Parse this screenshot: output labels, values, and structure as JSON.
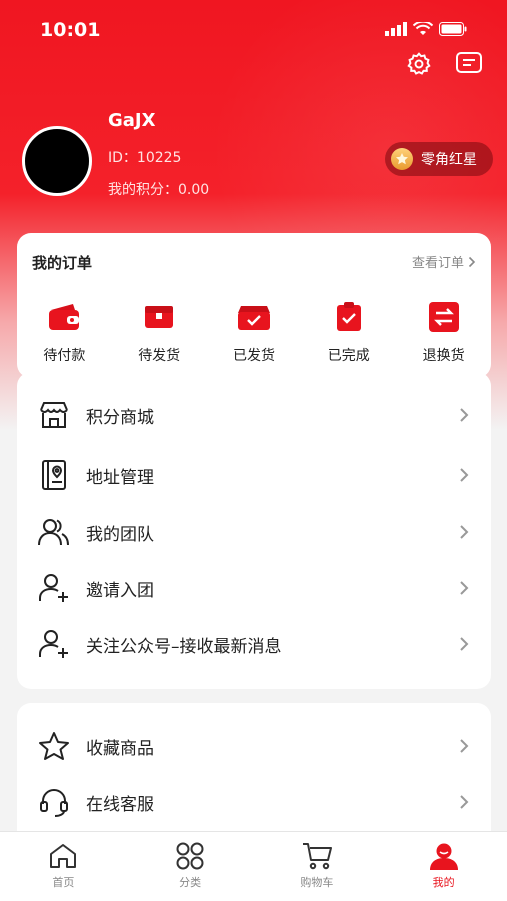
{
  "status_bar": {
    "time": "10:01"
  },
  "profile": {
    "username": "GaJX",
    "id_text": "ID：10225",
    "points_text": "我的积分：0.00",
    "level_badge": "零角红星"
  },
  "orders": {
    "title": "我的订单",
    "view_all": "查看订单",
    "items": [
      {
        "label": "待付款",
        "icon": "wallet-icon"
      },
      {
        "label": "待发货",
        "icon": "package-icon"
      },
      {
        "label": "已发货",
        "icon": "shipped-box-icon"
      },
      {
        "label": "已完成",
        "icon": "clipboard-check-icon"
      },
      {
        "label": "退换货",
        "icon": "exchange-icon"
      }
    ]
  },
  "menu_primary": [
    {
      "label": "积分商城",
      "icon": "store-icon"
    },
    {
      "label": "地址管理",
      "icon": "address-book-icon"
    },
    {
      "label": "我的团队",
      "icon": "team-icon"
    },
    {
      "label": "邀请入团",
      "icon": "add-user-icon"
    },
    {
      "label": "关注公众号–接收最新消息",
      "icon": "add-user-icon"
    }
  ],
  "menu_secondary": [
    {
      "label": "收藏商品",
      "icon": "star-icon"
    },
    {
      "label": "在线客服",
      "icon": "headset-icon"
    }
  ],
  "tabbar": [
    {
      "label": "首页",
      "icon": "home-icon"
    },
    {
      "label": "分类",
      "icon": "category-icon"
    },
    {
      "label": "购物车",
      "icon": "cart-icon"
    },
    {
      "label": "我的",
      "icon": "profile-icon",
      "active": true
    }
  ],
  "colors": {
    "brand_red": "#e8141e",
    "hero_red": "#f01621"
  }
}
